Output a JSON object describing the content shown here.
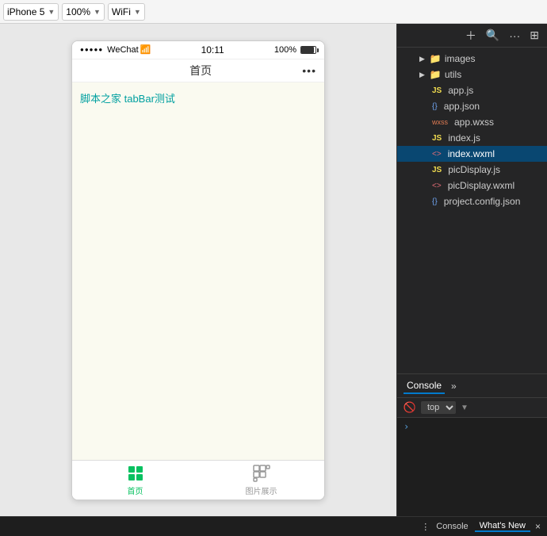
{
  "toolbar": {
    "device_label": "iPhone 5",
    "scale_label": "100%",
    "network_label": "WiFi"
  },
  "phone": {
    "status": {
      "signal": "●●●●●",
      "app_name": "WeChat",
      "wifi_icon": "📶",
      "time": "10:11",
      "battery_pct": "100%"
    },
    "nav": {
      "title": "首页",
      "dots": "•••"
    },
    "content": {
      "text": "脚本之家 tabBar测试"
    },
    "tabs": [
      {
        "label": "首页",
        "active": true
      },
      {
        "label": "图片展示",
        "active": false
      }
    ]
  },
  "file_panel": {
    "toolbar_icons": [
      "+",
      "🔍",
      "···",
      "⊞"
    ],
    "tree": [
      {
        "id": "images-folder",
        "indent": 1,
        "type": "folder",
        "name": "images",
        "arrow": "▶"
      },
      {
        "id": "utils-folder",
        "indent": 1,
        "type": "folder",
        "name": "utils",
        "arrow": "▶"
      },
      {
        "id": "app-js",
        "indent": 2,
        "type": "js",
        "ext": "JS",
        "name": "app.js"
      },
      {
        "id": "app-json",
        "indent": 2,
        "type": "json",
        "ext": "{}",
        "name": "app.json"
      },
      {
        "id": "app-wxss",
        "indent": 2,
        "type": "wxss",
        "ext": "wxss",
        "name": "app.wxss"
      },
      {
        "id": "index-js",
        "indent": 2,
        "type": "js",
        "ext": "JS",
        "name": "index.js"
      },
      {
        "id": "index-wxml",
        "indent": 2,
        "type": "wxml",
        "ext": "<>",
        "name": "index.wxml",
        "active": true
      },
      {
        "id": "picDisplay-js",
        "indent": 2,
        "type": "js",
        "ext": "JS",
        "name": "picDisplay.js"
      },
      {
        "id": "picDisplay-wxml",
        "indent": 2,
        "type": "wxml",
        "ext": "<>",
        "name": "picDisplay.wxml"
      },
      {
        "id": "project-config",
        "indent": 2,
        "type": "json",
        "ext": "{}",
        "name": "project.config.json"
      }
    ]
  },
  "console": {
    "tab_label": "Console",
    "chevron": "»",
    "block_icon": "🚫",
    "scope_label": "top",
    "arrow_label": "›"
  },
  "status_bar": {
    "dots": "⋮",
    "console_label": "Console",
    "whats_new_label": "What's New",
    "close": "×"
  }
}
